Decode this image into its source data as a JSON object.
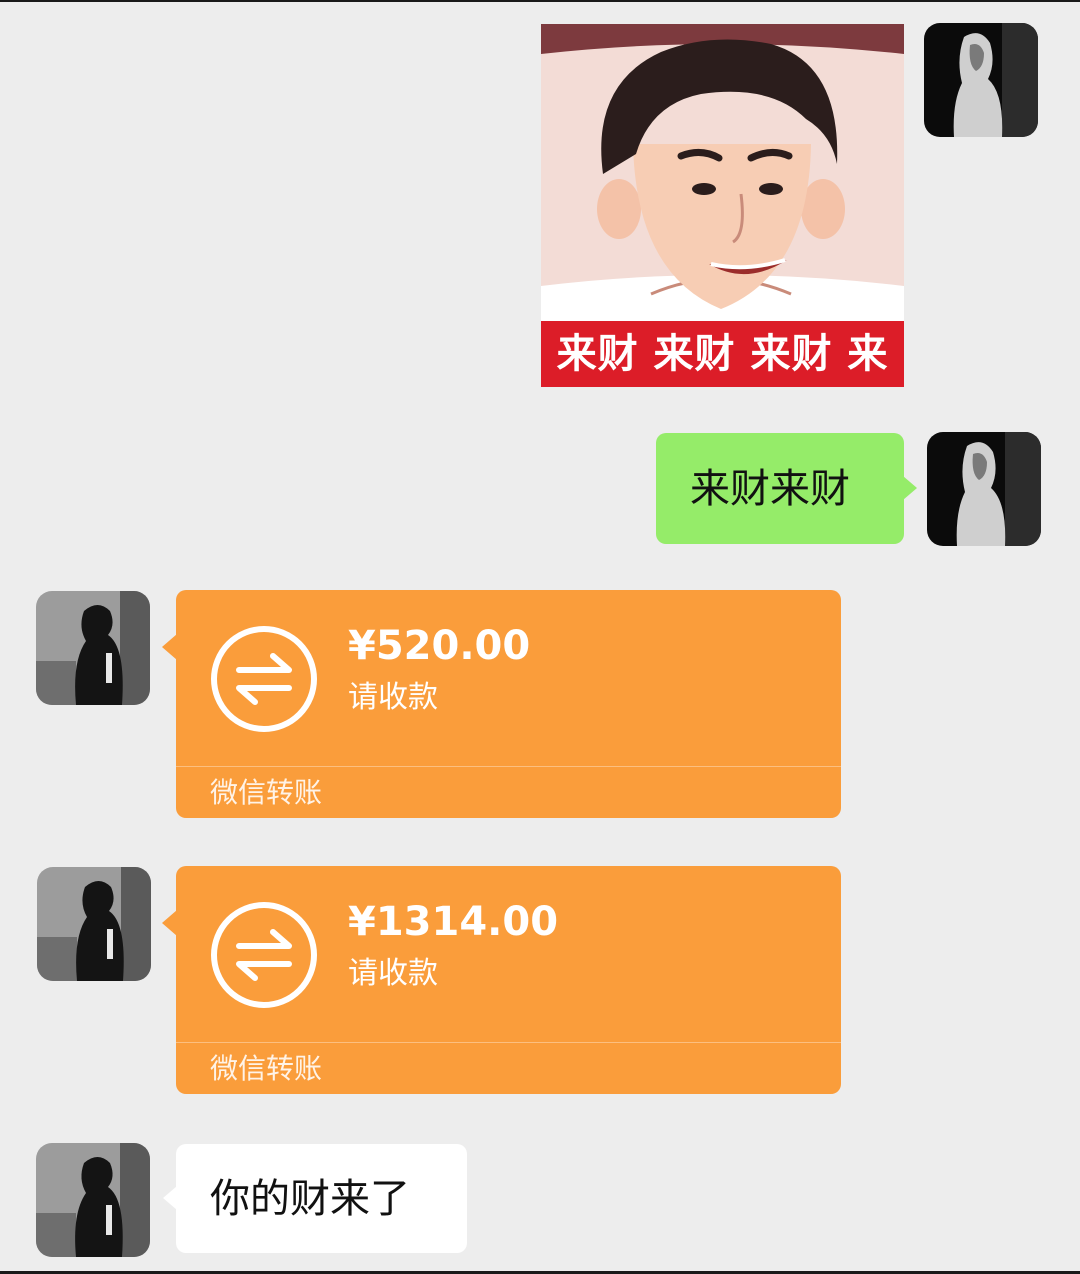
{
  "messages": {
    "sticker": {
      "caption": "来财 来财 来财 来"
    },
    "sent_text": "来财来财",
    "transfers": [
      {
        "amount": "¥520.00",
        "status": "请收款",
        "brand": "微信转账"
      },
      {
        "amount": "¥1314.00",
        "status": "请收款",
        "brand": "微信转账"
      }
    ],
    "received_text": "你的财来了"
  },
  "colors": {
    "chat_background": "#ededed",
    "sent_bubble": "#95ec69",
    "received_bubble": "#ffffff",
    "transfer_card": "#fa9d3b",
    "sticker_caption_band": "#dc1d28"
  },
  "icons": {
    "transfer": "transfer-arrows-icon",
    "sender_avatar": "avatar",
    "contact_avatar": "avatar"
  }
}
